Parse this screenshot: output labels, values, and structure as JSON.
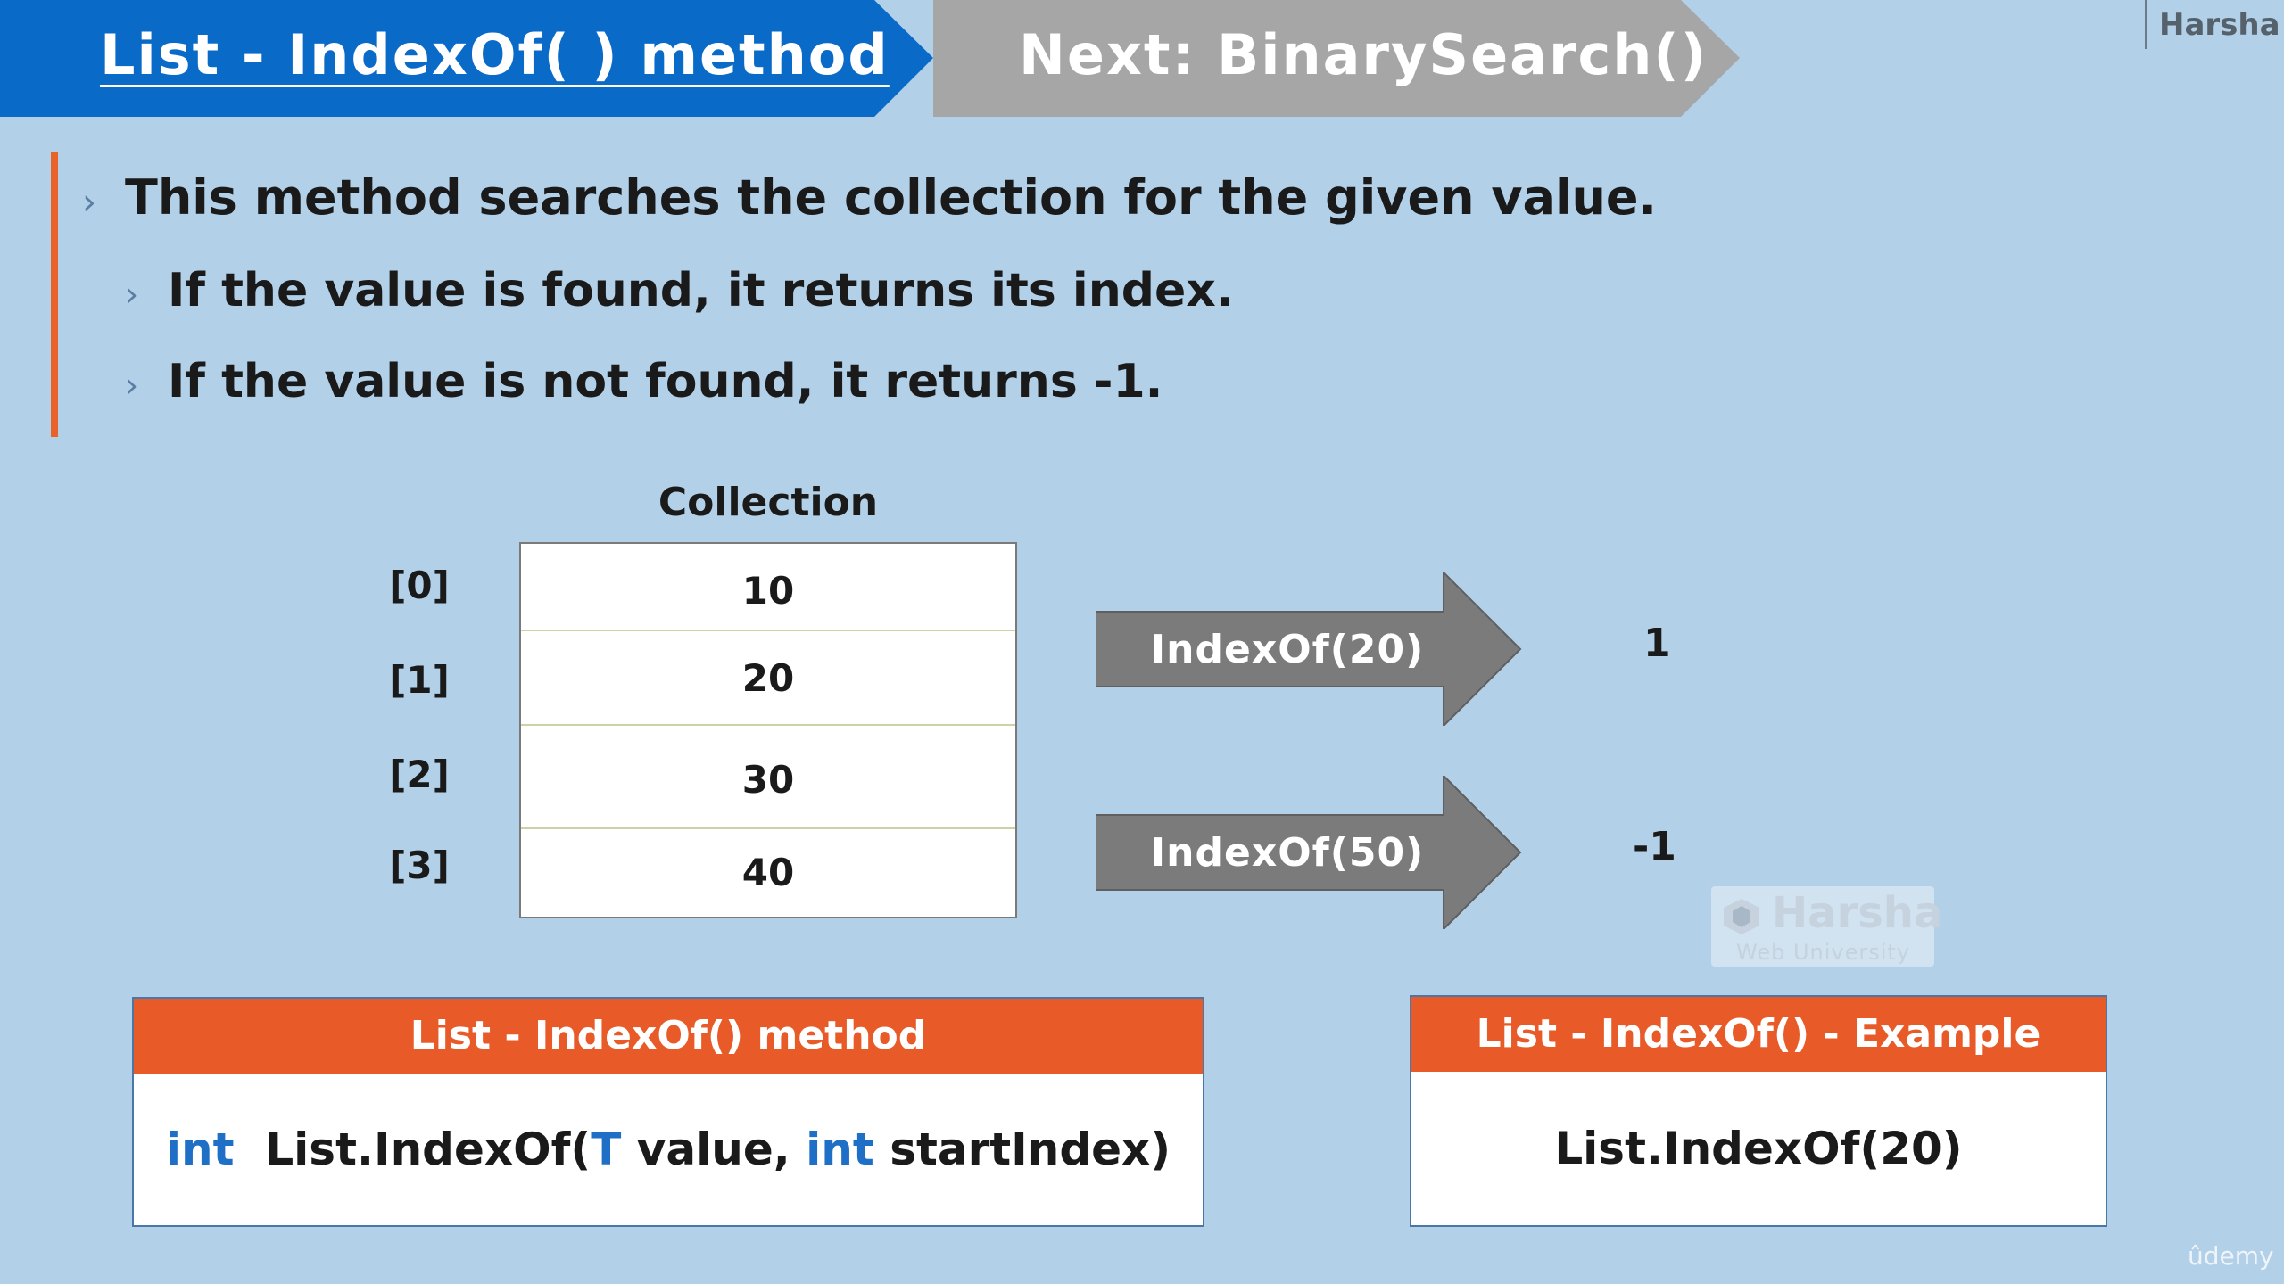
{
  "header": {
    "current_tab": "List - IndexOf( ) method",
    "next_tab": "Next: BinarySearch()",
    "brand": "Harsha"
  },
  "bullets": {
    "main": "This method searches the collection for the given value.",
    "sub1": "If the value is found, it returns its index.",
    "sub2": "If the value is not found, it returns -1."
  },
  "collection": {
    "title": "Collection",
    "indices": [
      "[0]",
      "[1]",
      "[2]",
      "[3]"
    ],
    "values": [
      "10",
      "20",
      "30",
      "40"
    ]
  },
  "calls": [
    {
      "label": "IndexOf(20)",
      "result": "1"
    },
    {
      "label": "IndexOf(50)",
      "result": "-1"
    }
  ],
  "watermark": {
    "name": "Harsha",
    "sub": "Web University"
  },
  "syntax_box": {
    "title": "List - IndexOf() method",
    "kw_int": "int",
    "signature_a": "List.IndexOf(",
    "kw_T": "T",
    "signature_b": " value, ",
    "kw_int2": "int",
    "signature_c": " startIndex)"
  },
  "example_box": {
    "title": "List - IndexOf() - Example",
    "code": "List.IndexOf(20)"
  },
  "footer": {
    "platform": "ûdemy"
  },
  "colors": {
    "background": "#b2d0e8",
    "current_tab": "#0a6ac8",
    "next_tab": "#a6a6a6",
    "accent_orange": "#e85b28",
    "arrow_gray": "#7b7b7b",
    "keyword_blue": "#1f6fc6"
  }
}
